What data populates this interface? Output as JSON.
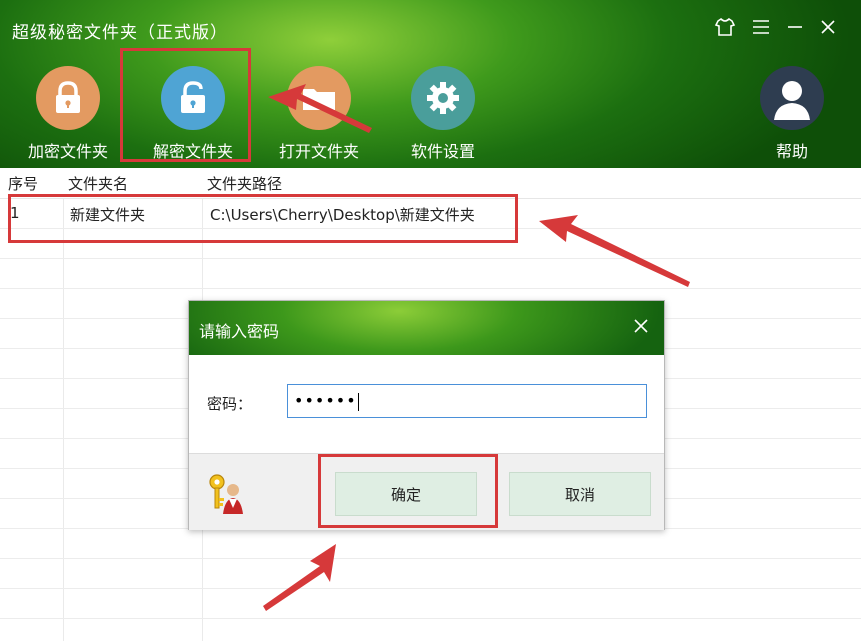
{
  "app": {
    "title": "超级秘密文件夹（正式版）",
    "window_controls": [
      "skin-icon",
      "menu-icon",
      "minimize-icon",
      "close-icon"
    ]
  },
  "toolbar": {
    "encrypt_label": "加密文件夹",
    "decrypt_label": "解密文件夹",
    "open_label": "打开文件夹",
    "settings_label": "软件设置",
    "help_label": "帮助"
  },
  "table": {
    "headers": [
      "序号",
      "文件夹名",
      "文件夹路径"
    ],
    "rows": [
      {
        "index": "1",
        "name": "新建文件夹",
        "path": "C:\\Users\\Cherry\\Desktop\\新建文件夹"
      }
    ]
  },
  "dialog": {
    "title": "请输入密码",
    "password_label": "密码：",
    "password_value": "••••••",
    "ok_label": "确定",
    "cancel_label": "取消"
  },
  "colors": {
    "header_green": "#2e8a18",
    "highlight_red": "#d6393a",
    "button_bg": "#dfeee3"
  }
}
